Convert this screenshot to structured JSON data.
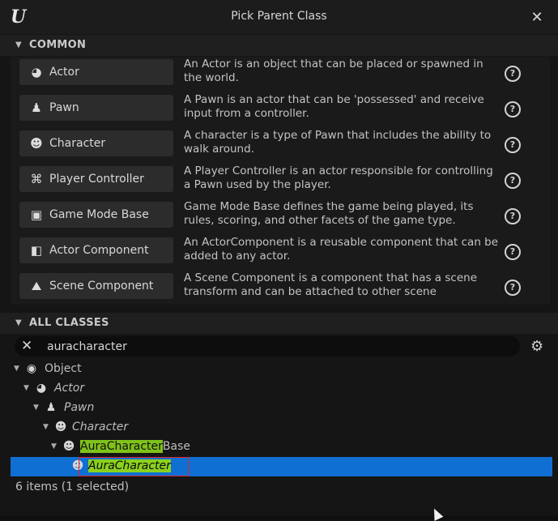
{
  "window": {
    "title": "Pick Parent Class",
    "logo_text": "U"
  },
  "common": {
    "header": "COMMON",
    "items": [
      {
        "label": "Actor",
        "icon": "actor-icon",
        "glyph": "◕",
        "desc": "An Actor is an object that can be placed or spawned in the world."
      },
      {
        "label": "Pawn",
        "icon": "pawn-icon",
        "glyph": "♟",
        "desc": "A Pawn is an actor that can be 'possessed' and receive input from a controller."
      },
      {
        "label": "Character",
        "icon": "character-icon",
        "glyph": "☻",
        "desc": "A character is a type of Pawn that includes the ability to walk around."
      },
      {
        "label": "Player Controller",
        "icon": "gamepad-icon",
        "glyph": "⌘",
        "desc": "A Player Controller is an actor responsible for controlling a Pawn used by the player."
      },
      {
        "label": "Game Mode Base",
        "icon": "game-mode-icon",
        "glyph": "▣",
        "desc": "Game Mode Base defines the game being played, its rules, scoring, and other facets of the game type."
      },
      {
        "label": "Actor Component",
        "icon": "component-icon",
        "glyph": "◧",
        "desc": "An ActorComponent is a reusable component that can be added to any actor."
      },
      {
        "label": "Scene Component",
        "icon": "scene-component-icon",
        "glyph": "⛰",
        "desc": "A Scene Component is a component that has a scene transform and can be attached to other scene"
      }
    ]
  },
  "all_classes": {
    "header": "ALL CLASSES",
    "search_value": "auracharacter",
    "tree": {
      "object": "Object",
      "actor": "Actor",
      "pawn": "Pawn",
      "character": "Character",
      "base_match": "AuraCharacter",
      "base_rest": "Base",
      "selected": "AuraCharacter"
    },
    "footer": "6 items (1 selected)"
  },
  "colors": {
    "selection": "#0f6fd3",
    "match_highlight": "#7fc21a",
    "annotation_box": "#e0242b"
  }
}
